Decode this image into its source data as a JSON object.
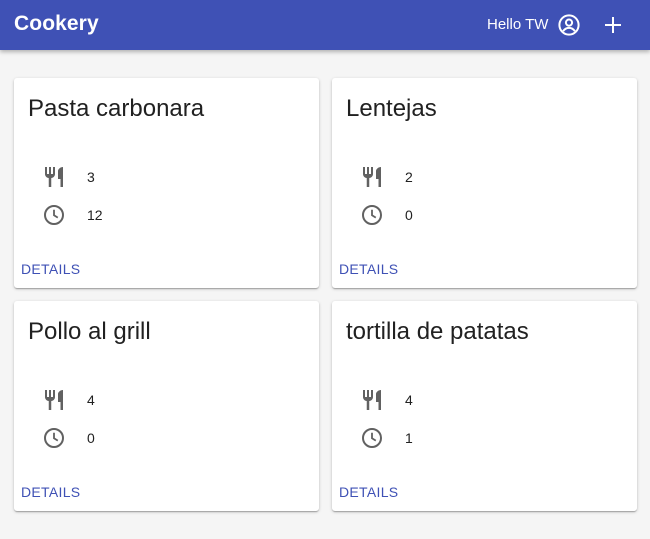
{
  "app": {
    "title": "Cookery",
    "greeting": "Hello TW",
    "brand_color": "#3f51b5",
    "account_icon": "account-circle-icon",
    "add_icon": "add-icon"
  },
  "recipes": [
    {
      "title": "Pasta carbonara",
      "servings": "3",
      "time": "12",
      "action_label": "DETAILS"
    },
    {
      "title": "Lentejas",
      "servings": "2",
      "time": "0",
      "action_label": "DETAILS"
    },
    {
      "title": "Pollo al grill",
      "servings": "4",
      "time": "0",
      "action_label": "DETAILS"
    },
    {
      "title": "tortilla de patatas",
      "servings": "4",
      "time": "1",
      "action_label": "DETAILS"
    }
  ],
  "icons": {
    "servings": "restaurant-icon",
    "time": "clock-icon"
  }
}
